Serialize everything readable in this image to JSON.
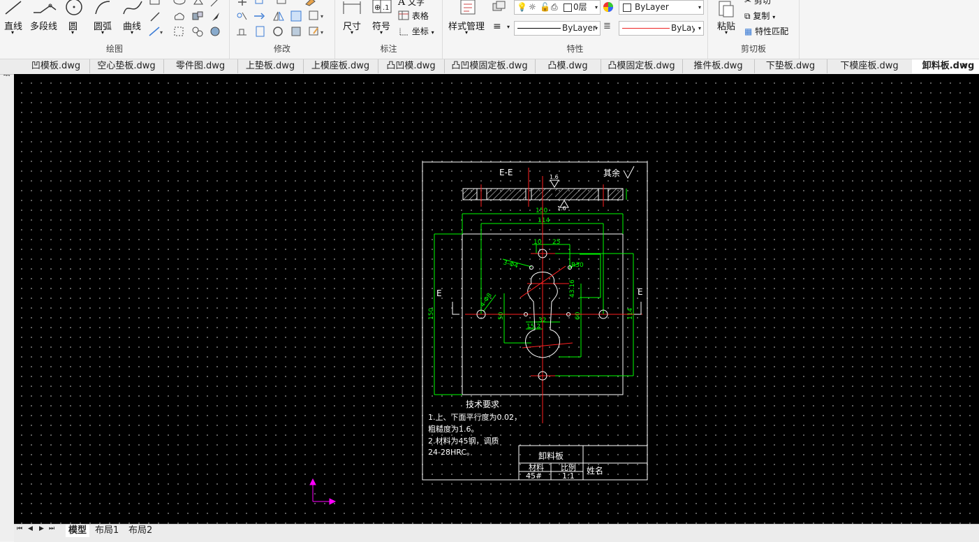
{
  "ribbon": {
    "draw": {
      "title": "绘图",
      "line": "直线",
      "polyline": "多段线",
      "circle": "圆",
      "arc": "圆弧",
      "curve": "曲线"
    },
    "modify": {
      "title": "修改"
    },
    "annotate": {
      "title": "标注",
      "dimension": "尺寸",
      "symbol": "符号",
      "text": "文字",
      "table": "表格",
      "coordinate": "坐标"
    },
    "properties": {
      "title": "特性",
      "style_manager": "样式管理",
      "layer_value": "0层",
      "color_value": "ByLayer",
      "linetype_value": "ByLayer",
      "lineweight_value": "ByLayer"
    },
    "clipboard": {
      "title": "剪切板",
      "paste": "粘贴",
      "cut": "剪切",
      "copy": "复制",
      "match": "特性匹配"
    }
  },
  "tabs": [
    "凹模板.dwg",
    "空心垫板.dwg",
    "零件图.dwg",
    "上垫板.dwg",
    "上模座板.dwg",
    "凸凹模.dwg",
    "凸凹模固定板.dwg",
    "凸模.dwg",
    "凸模固定板.dwg",
    "推件板.dwg",
    "下垫板.dwg",
    "下模座板.dwg",
    "卸料板.dwg"
  ],
  "active_tab": "卸料板.dwg",
  "close_glyph": "✕",
  "leftbar": {
    "label": "图纸"
  },
  "layout_tabs": [
    "模型",
    "布局1",
    "布局2"
  ],
  "drawing": {
    "section_label": "E-E",
    "rough_other": "其余",
    "rough_16": "1.6",
    "dim_150": "150",
    "dim_114": "114",
    "dim_10": "10",
    "dim_25": "25",
    "dim_r30": "R30",
    "dim_3d4": "3-Φ4",
    "dim_4d8": "4-Φ8",
    "dim_43_16": "43.16",
    "dim_50": "50",
    "dim_60": "60",
    "dim_32": "32",
    "dim_15_2": "15.2",
    "dim_150v": "150",
    "dim_114v": "114",
    "label_e": "E",
    "tech_title": "技术要求",
    "tech_line1": "1.上、下面平行度为0.02，",
    "tech_line2": "粗糙度为1.6。",
    "tech_line3": "2.材料为45钢，调质",
    "tech_line4": "24-28HRC。",
    "tb_name": "卸料板",
    "tb_material_label": "材料",
    "tb_scale_label": "比例",
    "tb_material": "45#",
    "tb_scale": "1:1",
    "tb_person": "姓名"
  },
  "colors": {
    "canvas": "#000000",
    "white": "#ffffff",
    "red": "#ff2020",
    "green": "#00ff00",
    "magenta": "#ff00ff"
  }
}
